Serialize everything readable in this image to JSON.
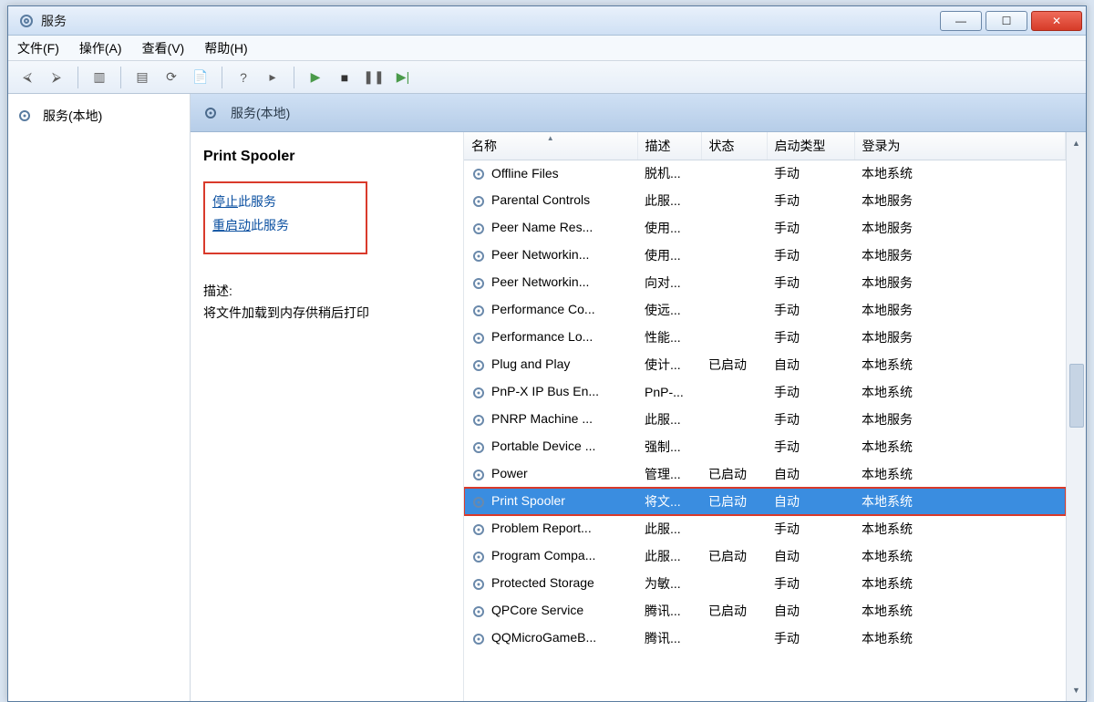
{
  "window": {
    "title": "服务"
  },
  "menu": {
    "file": "文件(F)",
    "action": "操作(A)",
    "view": "查看(V)",
    "help": "帮助(H)"
  },
  "nav": {
    "root": "服务(本地)"
  },
  "mainHeader": "服务(本地)",
  "detail": {
    "selectedName": "Print Spooler",
    "stopLink": "停止",
    "stopSuffix": "此服务",
    "restartLink": "重启动",
    "restartSuffix": "此服务",
    "descLabel": "描述:",
    "descText": "将文件加载到内存供稍后打印"
  },
  "columns": {
    "name": "名称",
    "desc": "描述",
    "status": "状态",
    "startup": "启动类型",
    "logon": "登录为"
  },
  "services": [
    {
      "name": "Offline Files",
      "desc": "脱机...",
      "status": "",
      "startup": "手动",
      "logon": "本地系统"
    },
    {
      "name": "Parental Controls",
      "desc": "此服...",
      "status": "",
      "startup": "手动",
      "logon": "本地服务"
    },
    {
      "name": "Peer Name Res...",
      "desc": "使用...",
      "status": "",
      "startup": "手动",
      "logon": "本地服务"
    },
    {
      "name": "Peer Networkin...",
      "desc": "使用...",
      "status": "",
      "startup": "手动",
      "logon": "本地服务"
    },
    {
      "name": "Peer Networkin...",
      "desc": "向对...",
      "status": "",
      "startup": "手动",
      "logon": "本地服务"
    },
    {
      "name": "Performance Co...",
      "desc": "使远...",
      "status": "",
      "startup": "手动",
      "logon": "本地服务"
    },
    {
      "name": "Performance Lo...",
      "desc": "性能...",
      "status": "",
      "startup": "手动",
      "logon": "本地服务"
    },
    {
      "name": "Plug and Play",
      "desc": "使计...",
      "status": "已启动",
      "startup": "自动",
      "logon": "本地系统"
    },
    {
      "name": "PnP-X IP Bus En...",
      "desc": "PnP-...",
      "status": "",
      "startup": "手动",
      "logon": "本地系统"
    },
    {
      "name": "PNRP Machine ...",
      "desc": "此服...",
      "status": "",
      "startup": "手动",
      "logon": "本地服务"
    },
    {
      "name": "Portable Device ...",
      "desc": "强制...",
      "status": "",
      "startup": "手动",
      "logon": "本地系统"
    },
    {
      "name": "Power",
      "desc": "管理...",
      "status": "已启动",
      "startup": "自动",
      "logon": "本地系统"
    },
    {
      "name": "Print Spooler",
      "desc": "将文...",
      "status": "已启动",
      "startup": "自动",
      "logon": "本地系统",
      "selected": true
    },
    {
      "name": "Problem Report...",
      "desc": "此服...",
      "status": "",
      "startup": "手动",
      "logon": "本地系统"
    },
    {
      "name": "Program Compa...",
      "desc": "此服...",
      "status": "已启动",
      "startup": "自动",
      "logon": "本地系统"
    },
    {
      "name": "Protected Storage",
      "desc": "为敏...",
      "status": "",
      "startup": "手动",
      "logon": "本地系统"
    },
    {
      "name": "QPCore Service",
      "desc": "腾讯...",
      "status": "已启动",
      "startup": "自动",
      "logon": "本地系统"
    },
    {
      "name": "QQMicroGameB...",
      "desc": "腾讯...",
      "status": "",
      "startup": "手动",
      "logon": "本地系统"
    }
  ]
}
